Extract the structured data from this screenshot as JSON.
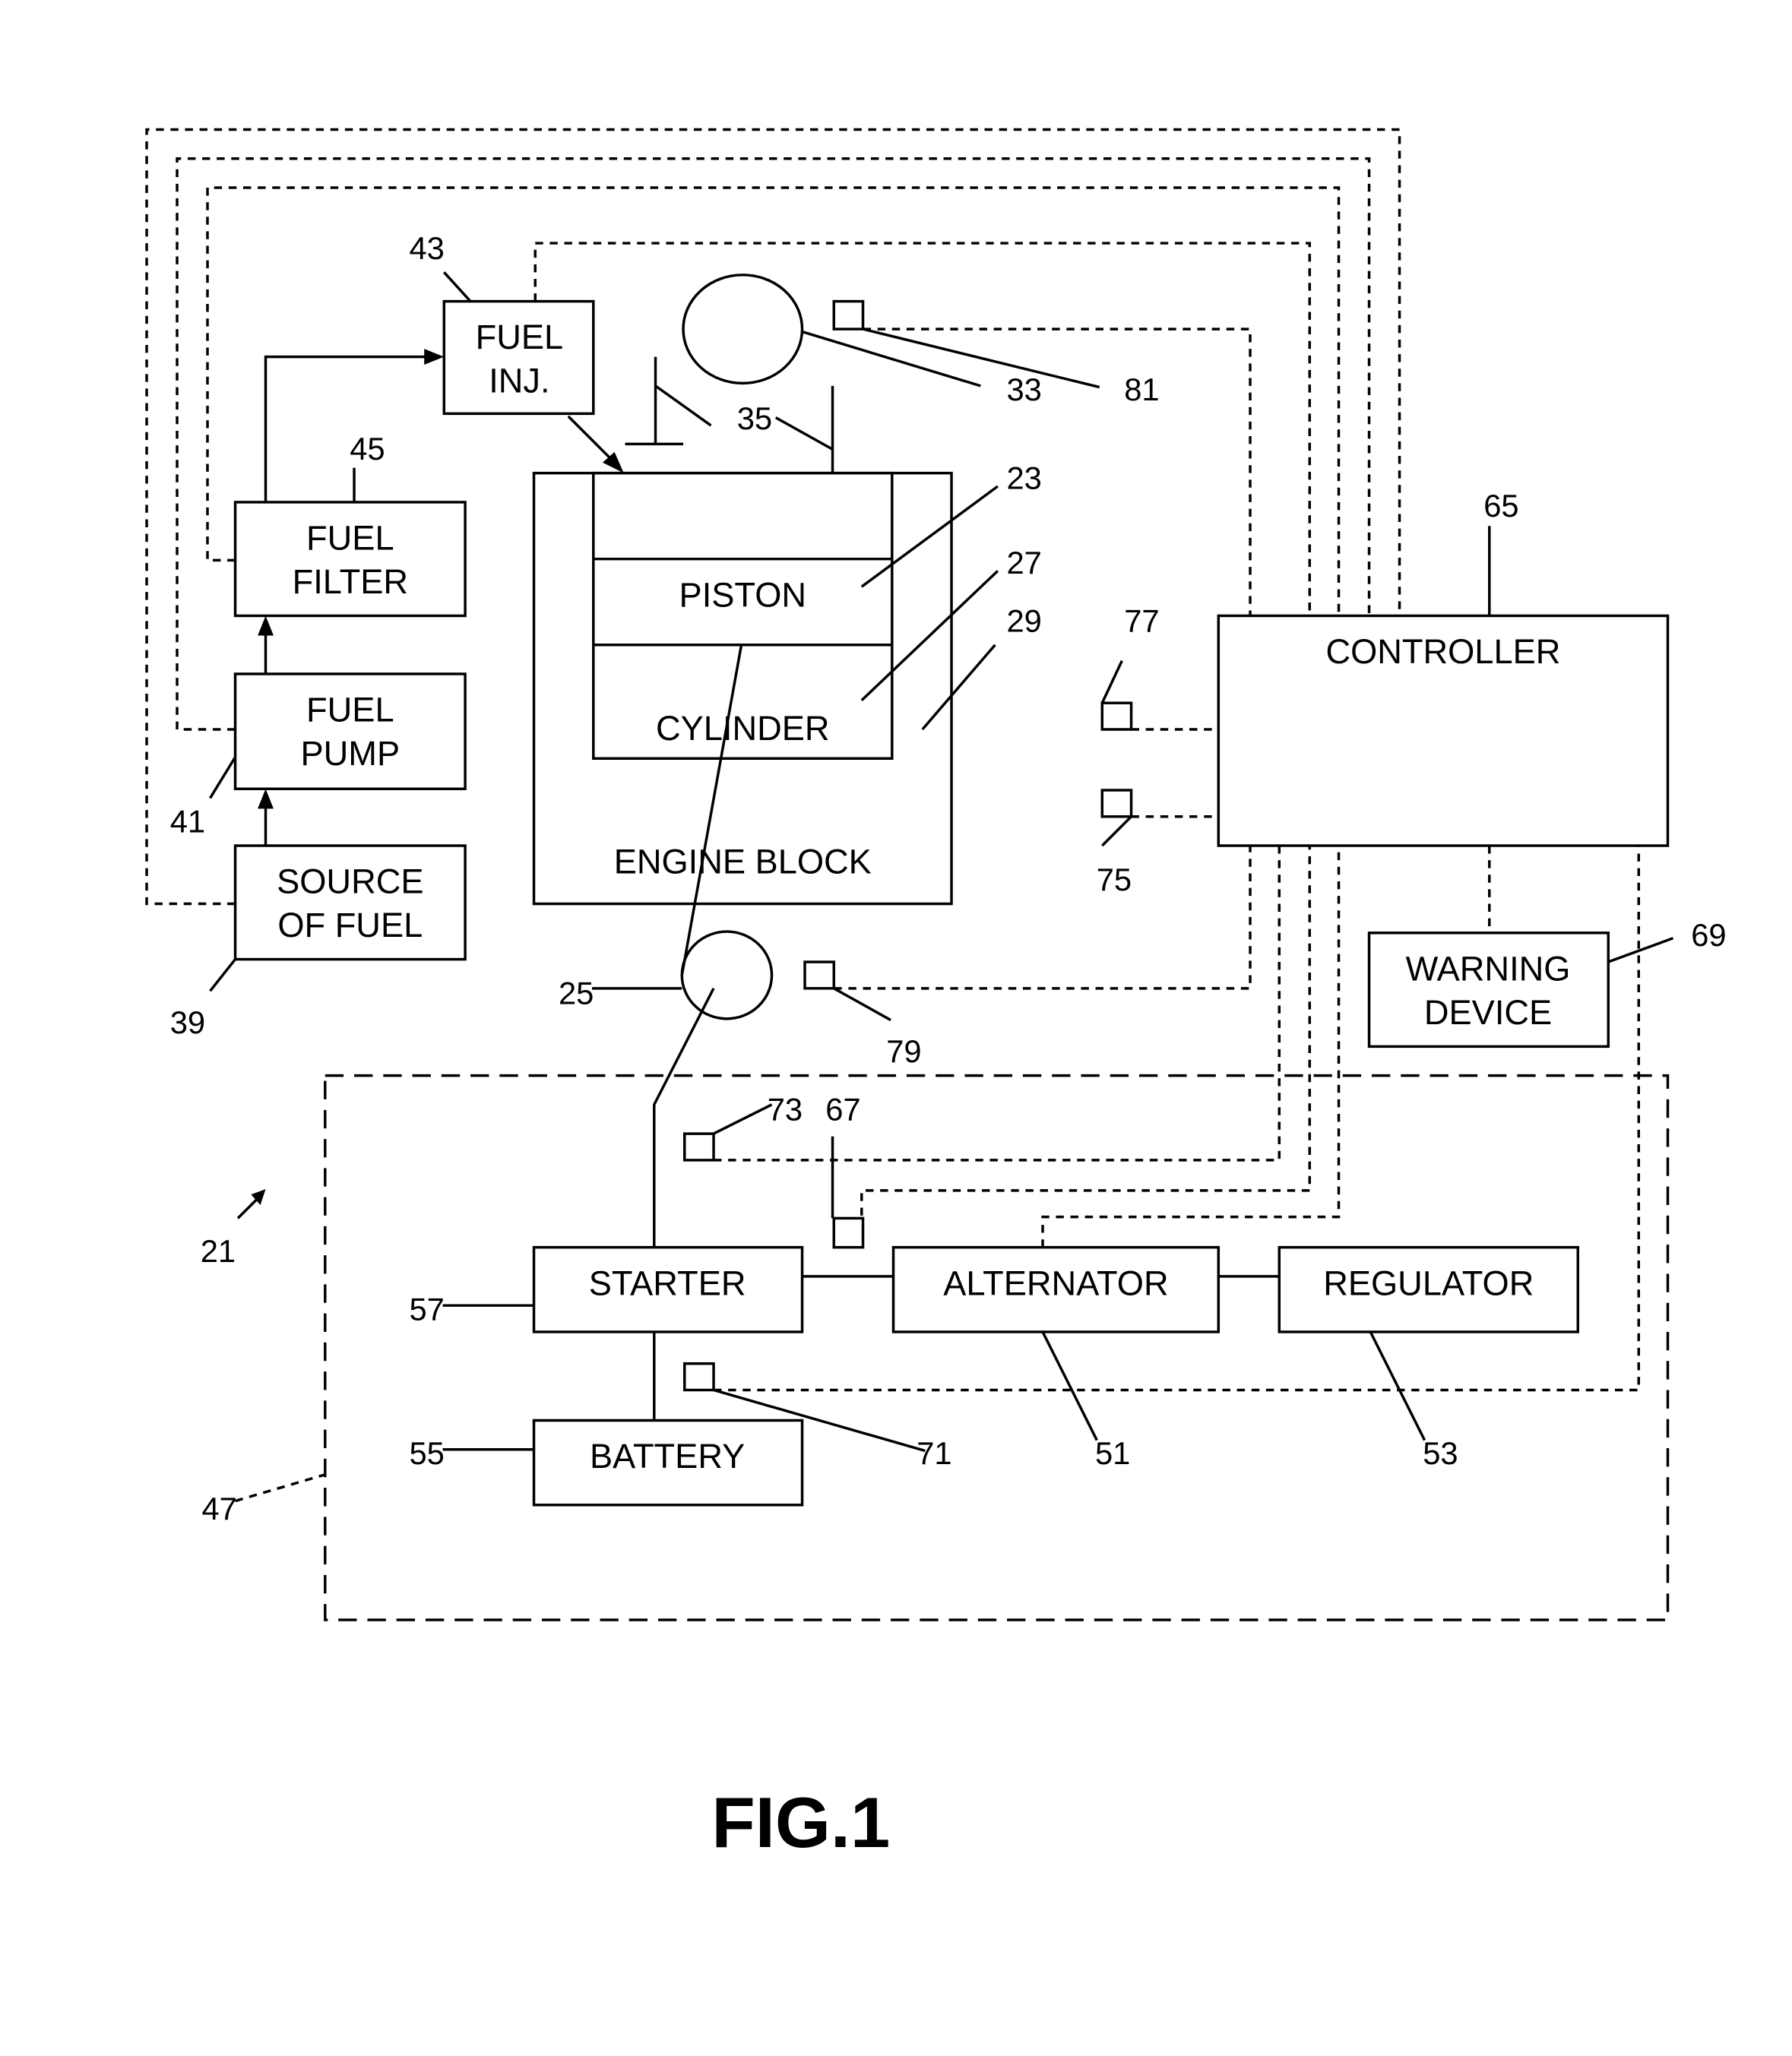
{
  "figure": {
    "caption": "FIG.1",
    "system_ref": "21",
    "electrical_system_ref": "47"
  },
  "blocks": {
    "fuel_inj": {
      "line1": "FUEL",
      "line2": "INJ.",
      "ref": "43"
    },
    "fuel_filter": {
      "line1": "FUEL",
      "line2": "FILTER",
      "ref": "45"
    },
    "fuel_pump": {
      "line1": "FUEL",
      "line2": "PUMP",
      "ref": "41"
    },
    "source_of_fuel": {
      "line1": "SOURCE",
      "line2": "OF FUEL",
      "ref": "39"
    },
    "piston": {
      "label": "PISTON",
      "ref": "23"
    },
    "cylinder": {
      "label": "CYLINDER",
      "ref": "27"
    },
    "engine_block": {
      "label": "ENGINE BLOCK",
      "ref": "29"
    },
    "controller": {
      "label": "CONTROLLER",
      "ref": "65"
    },
    "warning_device": {
      "line1": "WARNING",
      "line2": "DEVICE",
      "ref": "69"
    },
    "starter": {
      "label": "STARTER",
      "ref": "57"
    },
    "alternator": {
      "label": "ALTERNATOR",
      "ref": "51"
    },
    "regulator": {
      "label": "REGULATOR",
      "ref": "53"
    },
    "battery": {
      "label": "BATTERY",
      "ref": "55"
    }
  },
  "components": {
    "camshaft": {
      "ref": "33"
    },
    "crankshaft": {
      "ref": "25"
    },
    "valves": {
      "ref": "35"
    }
  },
  "sensors": {
    "cam_sensor": {
      "ref": "81"
    },
    "crank_sensor": {
      "ref": "79"
    },
    "sensor_77": {
      "ref": "77"
    },
    "sensor_75": {
      "ref": "75"
    },
    "sensor_73": {
      "ref": "73"
    },
    "sensor_67": {
      "ref": "67"
    },
    "sensor_71": {
      "ref": "71"
    }
  }
}
